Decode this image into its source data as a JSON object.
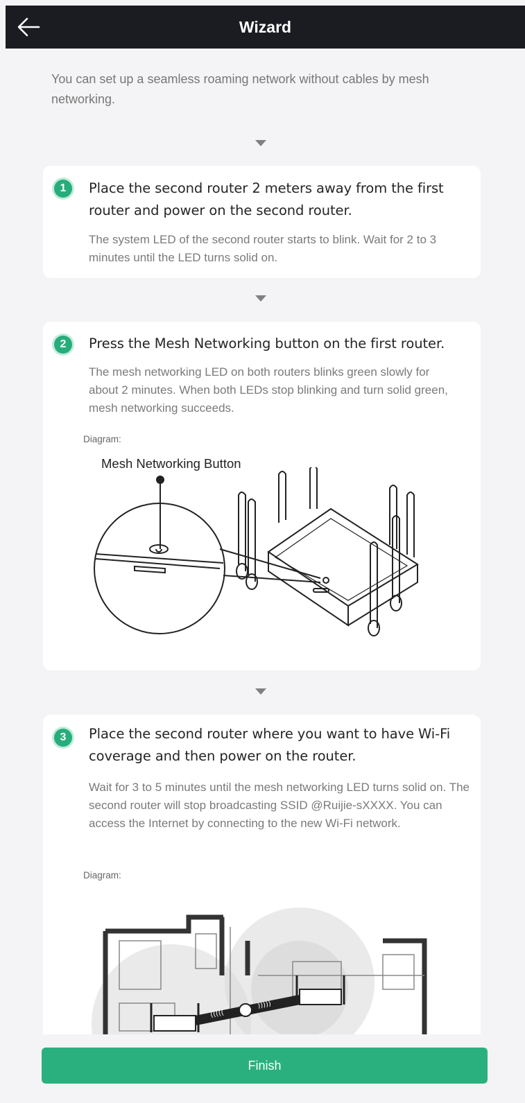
{
  "header": {
    "title": "Wizard",
    "back_icon": "arrow-left-icon"
  },
  "intro": "You can set up a seamless roaming network without cables by mesh networking.",
  "steps": [
    {
      "number": "1",
      "title": "Place the second router 2 meters away from the first router and power on the second router.",
      "description": "The system LED of the second router starts to blink. Wait for 2 to 3 minutes until the LED turns solid on."
    },
    {
      "number": "2",
      "title": "Press the Mesh Networking button on the first router.",
      "description": "The mesh networking LED on both routers blinks green slowly for about 2 minutes. When both LEDs stop blinking and turn solid green, mesh networking succeeds.",
      "diagram_label": "Diagram:",
      "diagram_callout": "Mesh Networking Button"
    },
    {
      "number": "3",
      "title": "Place the second router where you want to have Wi-Fi coverage and then power on the router.",
      "description": "Wait for 3 to 5 minutes until the mesh networking LED turns solid on. The second router will stop broadcasting SSID @Ruijie-sXXXX. You can access the Internet by connecting to the new Wi-Fi network.",
      "diagram_label": "Diagram:"
    }
  ],
  "footer": {
    "finish_label": "Finish"
  },
  "colors": {
    "accent": "#2ab07e",
    "header_bg": "#1a1c22",
    "page_bg": "#f4f4f6"
  }
}
